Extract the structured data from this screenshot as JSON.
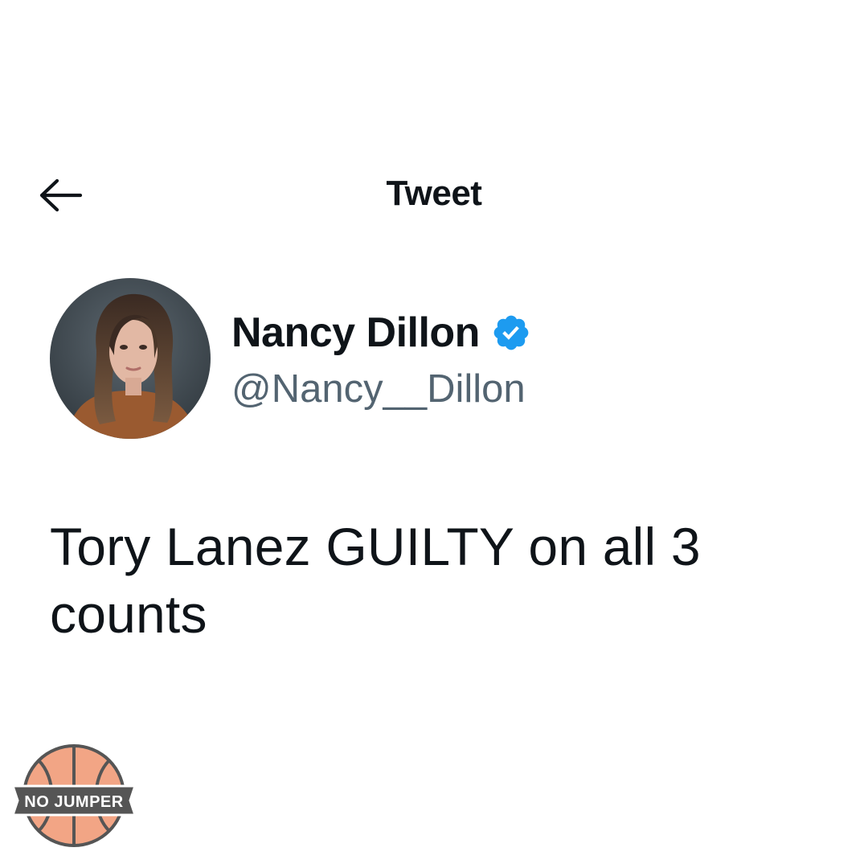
{
  "header": {
    "back_icon": "arrow-left-icon",
    "title": "Tweet"
  },
  "author": {
    "display_name": "Nancy Dillon",
    "handle": "@Nancy__Dillon",
    "verified": true,
    "verified_icon": "verified-badge-icon",
    "verified_color": "#1d9bf0"
  },
  "tweet": {
    "text": "Tory Lanez GUILTY on all 3 counts"
  },
  "watermark": {
    "text": "NO JUMPER",
    "icon": "basketball-logo"
  },
  "colors": {
    "text_primary": "#0f1419",
    "text_secondary": "#536471",
    "accent": "#1d9bf0",
    "background": "#ffffff"
  }
}
